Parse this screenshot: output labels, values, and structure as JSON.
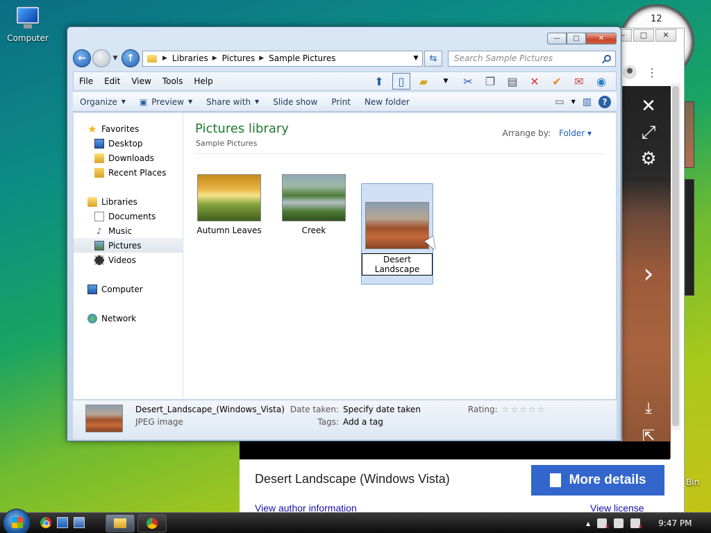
{
  "desktop": {
    "computer_label": "Computer",
    "recycle_label": "Bin"
  },
  "clock_gadget": {
    "twelve": "12"
  },
  "browser": {
    "window_controls": [
      "—",
      "□",
      "✕"
    ],
    "image_title": "Desert Landscape (Windows Vista)",
    "more_details_label": "More details",
    "author_link": "View author information",
    "license_link": "View license"
  },
  "explorer": {
    "window_controls": {
      "minimize": "—",
      "maximize": "□",
      "close": "✕"
    },
    "address": {
      "crumbs": [
        "Libraries",
        "Pictures",
        "Sample Pictures"
      ]
    },
    "search_placeholder": "Search Sample Pictures",
    "menu": [
      "File",
      "Edit",
      "View",
      "Tools",
      "Help"
    ],
    "commands": {
      "organize": "Organize",
      "preview": "Preview",
      "share_with": "Share with",
      "slide_show": "Slide show",
      "print": "Print",
      "new_folder": "New folder"
    },
    "nav": {
      "favorites": "Favorites",
      "desktop": "Desktop",
      "downloads": "Downloads",
      "recent_places": "Recent Places",
      "libraries": "Libraries",
      "documents": "Documents",
      "music": "Music",
      "pictures": "Pictures",
      "videos": "Videos",
      "computer": "Computer",
      "network": "Network"
    },
    "library": {
      "title": "Pictures library",
      "subtitle": "Sample Pictures",
      "arrange_label": "Arrange by:",
      "arrange_value": "Folder"
    },
    "items": [
      {
        "name": "Autumn Leaves"
      },
      {
        "name": "Creek"
      },
      {
        "name": "Desert Landscape"
      }
    ],
    "details": {
      "filename": "Desert_Landscape_(Windows_Vista)",
      "type": "JPEG image",
      "date_taken_label": "Date taken:",
      "date_taken_value": "Specify date taken",
      "tags_label": "Tags:",
      "tags_value": "Add a tag",
      "rating_label": "Rating:",
      "rating_value": 0,
      "rating_max": 5
    }
  },
  "taskbar": {
    "time": "9:47 PM"
  }
}
